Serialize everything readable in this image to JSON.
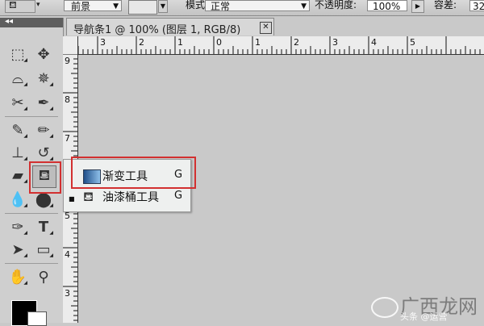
{
  "options_bar": {
    "tool_icon": "paint-bucket-icon",
    "fill_source": "前景",
    "mode_label": "模式:",
    "mode_value": "正常",
    "opacity_label": "不透明度:",
    "opacity_value": "100%",
    "tolerance_label": "容差:",
    "tolerance_value": "32"
  },
  "document": {
    "tab_title": "导航条1 @ 100% (图层 1, RGB/8)",
    "close_glyph": "✕"
  },
  "rulers": {
    "top_labels": [
      "3",
      "2",
      "1",
      "0",
      "1",
      "2",
      "3",
      "4",
      "5"
    ],
    "left_labels": [
      "9",
      "8",
      "7",
      "6",
      "5",
      "4",
      "3",
      "2"
    ]
  },
  "toolbox": {
    "collapse_glyph": "◂◂",
    "tools": [
      {
        "name": "rect-marquee-icon",
        "glyph": "⬚"
      },
      {
        "name": "move-icon",
        "glyph": "✥"
      },
      {
        "name": "lasso-icon",
        "glyph": "ᘓ"
      },
      {
        "name": "magic-wand-icon",
        "glyph": "✵"
      },
      {
        "name": "crop-icon",
        "glyph": "⌗"
      },
      {
        "name": "eyedropper-icon",
        "glyph": "✒"
      },
      {
        "name": "healing-brush-icon",
        "glyph": "✎"
      },
      {
        "name": "brush-icon",
        "glyph": "✏"
      },
      {
        "name": "clone-stamp-icon",
        "glyph": "⊥"
      },
      {
        "name": "history-brush-icon",
        "glyph": "↺"
      },
      {
        "name": "eraser-icon",
        "glyph": "▰"
      },
      {
        "name": "paint-bucket-icon",
        "glyph": "◉"
      },
      {
        "name": "blur-icon",
        "glyph": "●"
      },
      {
        "name": "dodge-icon",
        "glyph": "⬤"
      },
      {
        "name": "pen-icon",
        "glyph": "✑"
      },
      {
        "name": "type-icon",
        "glyph": "T"
      },
      {
        "name": "path-select-icon",
        "glyph": "➤"
      },
      {
        "name": "rectangle-shape-icon",
        "glyph": "▭"
      },
      {
        "name": "hand-icon",
        "glyph": "✋"
      },
      {
        "name": "zoom-icon",
        "glyph": "⚲"
      }
    ],
    "swap_glyph": "↰",
    "foreground_color": "#000000",
    "background_color": "#ffffff"
  },
  "flyout": {
    "items": [
      {
        "label": "渐变工具",
        "shortcut": "G",
        "icon": "gradient-icon",
        "selected": true
      },
      {
        "label": "油漆桶工具",
        "shortcut": "G",
        "icon": "paint-bucket-icon",
        "selected": false
      }
    ],
    "bullet": "■"
  },
  "watermark": {
    "text": "广西龙网",
    "subtext": "头条 @运营"
  },
  "colors": {
    "highlight": "#d23030",
    "panel": "#cfcfcf",
    "canvas": "#c9c9c9"
  }
}
